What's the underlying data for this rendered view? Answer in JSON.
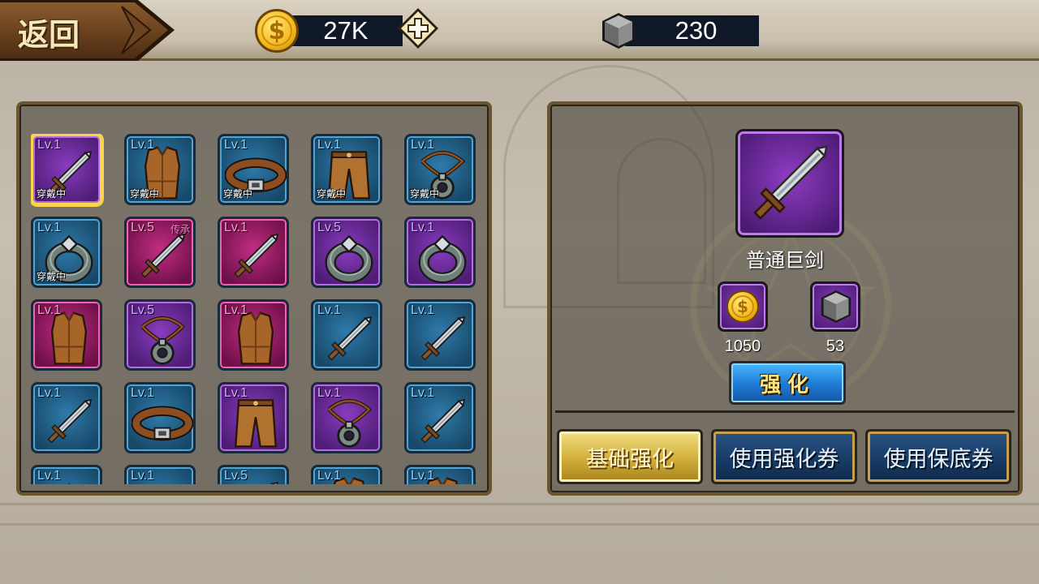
{
  "header": {
    "back_label": "返回",
    "gold": "27K",
    "stone": "230"
  },
  "inventory": {
    "equipped_text": "穿戴中",
    "legacy_text": "传承",
    "items": [
      {
        "lv": "Lv.1",
        "icon": "sword-icon",
        "rarity": "purple",
        "equipped": true,
        "selected": true
      },
      {
        "lv": "Lv.1",
        "icon": "vest-icon",
        "rarity": "blue",
        "equipped": true
      },
      {
        "lv": "Lv.1",
        "icon": "belt-icon",
        "rarity": "blue",
        "equipped": true
      },
      {
        "lv": "Lv.1",
        "icon": "pants-icon",
        "rarity": "blue",
        "equipped": true
      },
      {
        "lv": "Lv.1",
        "icon": "amulet-icon",
        "rarity": "blue",
        "equipped": true
      },
      {
        "lv": "Lv.1",
        "icon": "ring-icon",
        "rarity": "blue",
        "equipped": true
      },
      {
        "lv": "Lv.5",
        "icon": "sword-icon",
        "rarity": "pink",
        "legacy": true
      },
      {
        "lv": "Lv.1",
        "icon": "sword-icon",
        "rarity": "pink"
      },
      {
        "lv": "Lv.5",
        "icon": "ring-icon",
        "rarity": "purple"
      },
      {
        "lv": "Lv.1",
        "icon": "ring-icon",
        "rarity": "purple"
      },
      {
        "lv": "Lv.1",
        "icon": "vest-icon",
        "rarity": "pink"
      },
      {
        "lv": "Lv.5",
        "icon": "amulet-icon",
        "rarity": "purple"
      },
      {
        "lv": "Lv.1",
        "icon": "vest-icon",
        "rarity": "pink"
      },
      {
        "lv": "Lv.1",
        "icon": "sword-icon",
        "rarity": "blue"
      },
      {
        "lv": "Lv.1",
        "icon": "sword-icon",
        "rarity": "blue"
      },
      {
        "lv": "Lv.1",
        "icon": "sword-icon",
        "rarity": "blue"
      },
      {
        "lv": "Lv.1",
        "icon": "belt-icon",
        "rarity": "blue"
      },
      {
        "lv": "Lv.1",
        "icon": "pants-icon",
        "rarity": "purple"
      },
      {
        "lv": "Lv.1",
        "icon": "amulet-icon",
        "rarity": "purple"
      },
      {
        "lv": "Lv.1",
        "icon": "sword-icon",
        "rarity": "blue"
      },
      {
        "lv": "Lv.1",
        "icon": "ring-icon",
        "rarity": "blue"
      },
      {
        "lv": "Lv.1",
        "icon": "belt-icon",
        "rarity": "blue"
      },
      {
        "lv": "Lv.5",
        "icon": "sword-icon",
        "rarity": "blue"
      },
      {
        "lv": "Lv.1",
        "icon": "vest-icon",
        "rarity": "blue"
      },
      {
        "lv": "Lv.1",
        "icon": "vest-icon",
        "rarity": "blue"
      }
    ]
  },
  "detail": {
    "item_name": "普通巨剑",
    "item_icon": "sword-icon",
    "cost_gold": "1050",
    "cost_stone": "53",
    "enhance_label": "强化"
  },
  "tabs": {
    "basic": "基础强化",
    "ticket": "使用强化券",
    "guarantee": "使用保底券"
  },
  "colors": {
    "blue_rarity": "#2f7bab",
    "purple_rarity": "#8a3cbf",
    "pink_rarity": "#c12d84",
    "gold_accent": "#d2ae3a"
  }
}
